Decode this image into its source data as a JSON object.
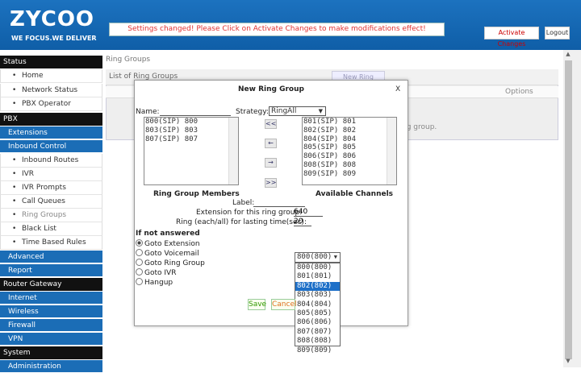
{
  "header": {
    "logo": "ZYCOO",
    "tagline": "WE FOCUS.WE DELIVER",
    "notice": "Settings changed! Please Click on Activate Changes to make modifications effect!",
    "activate_label": "Activate Changes",
    "logout_label": "Logout",
    "brand_color": "#1b6db6"
  },
  "sidebar": {
    "status": "Status",
    "home": "Home",
    "network_status": "Network Status",
    "pbx_operator": "PBX Operator",
    "pbx": "PBX",
    "extensions": "Extensions",
    "inbound_control": "Inbound Control",
    "inbound_routes": "Inbound Routes",
    "ivr": "IVR",
    "ivr_prompts": "IVR Prompts",
    "call_queues": "Call Queues",
    "ring_groups": "Ring Groups",
    "black_list": "Black List",
    "time_based_rules": "Time Based Rules",
    "advanced": "Advanced",
    "report": "Report",
    "router_gateway": "Router Gateway",
    "internet": "Internet",
    "wireless": "Wireless",
    "firewall": "Firewall",
    "vpn": "VPN",
    "system": "System",
    "administration": "Administration"
  },
  "main": {
    "breadcrumb": "Ring Groups",
    "panel_title": "List of Ring Groups",
    "new_group_link": "New Ring Group",
    "options_col": "Options",
    "empty_msg": "ng group."
  },
  "modal": {
    "title": "New Ring Group",
    "close": "X",
    "name_label": "Name:",
    "name_value": "",
    "strategy_label": "Strategy:",
    "strategy_value": "RingAll",
    "members": [
      "800(SIP) 800",
      "803(SIP) 803",
      "807(SIP) 807"
    ],
    "channels": [
      "801(SIP) 801",
      "802(SIP) 802",
      "804(SIP) 804",
      "805(SIP) 805",
      "806(SIP) 806",
      "808(SIP) 808",
      "809(SIP) 809"
    ],
    "btn_all_left": "<<",
    "btn_left": "←",
    "btn_right": "→",
    "btn_all_right": ">>",
    "members_label": "Ring Group Members",
    "channels_label": "Available Channels",
    "label_label": "Label:",
    "label_value": "",
    "extension_label": "Extension for this ring group:",
    "extension_value": "640",
    "ring_time_label": "Ring (each/all) for lasting time(sec):",
    "ring_time_value": "20",
    "if_not_answered": "If not answered",
    "goto_extension": "Goto Extension",
    "goto_voicemail": "Goto Voicemail",
    "goto_ring_group": "Goto Ring Group",
    "goto_ivr": "Goto IVR",
    "hangup": "Hangup",
    "dest_selected": "800(800)",
    "dest_options": [
      "800(800)",
      "801(801)",
      "802(802)",
      "803(803)",
      "804(804)",
      "805(805)",
      "806(806)",
      "807(807)",
      "808(808)",
      "809(809)"
    ],
    "dest_highlighted": "802(802)",
    "save_label": "Save",
    "cancel_label": "Cancel"
  }
}
